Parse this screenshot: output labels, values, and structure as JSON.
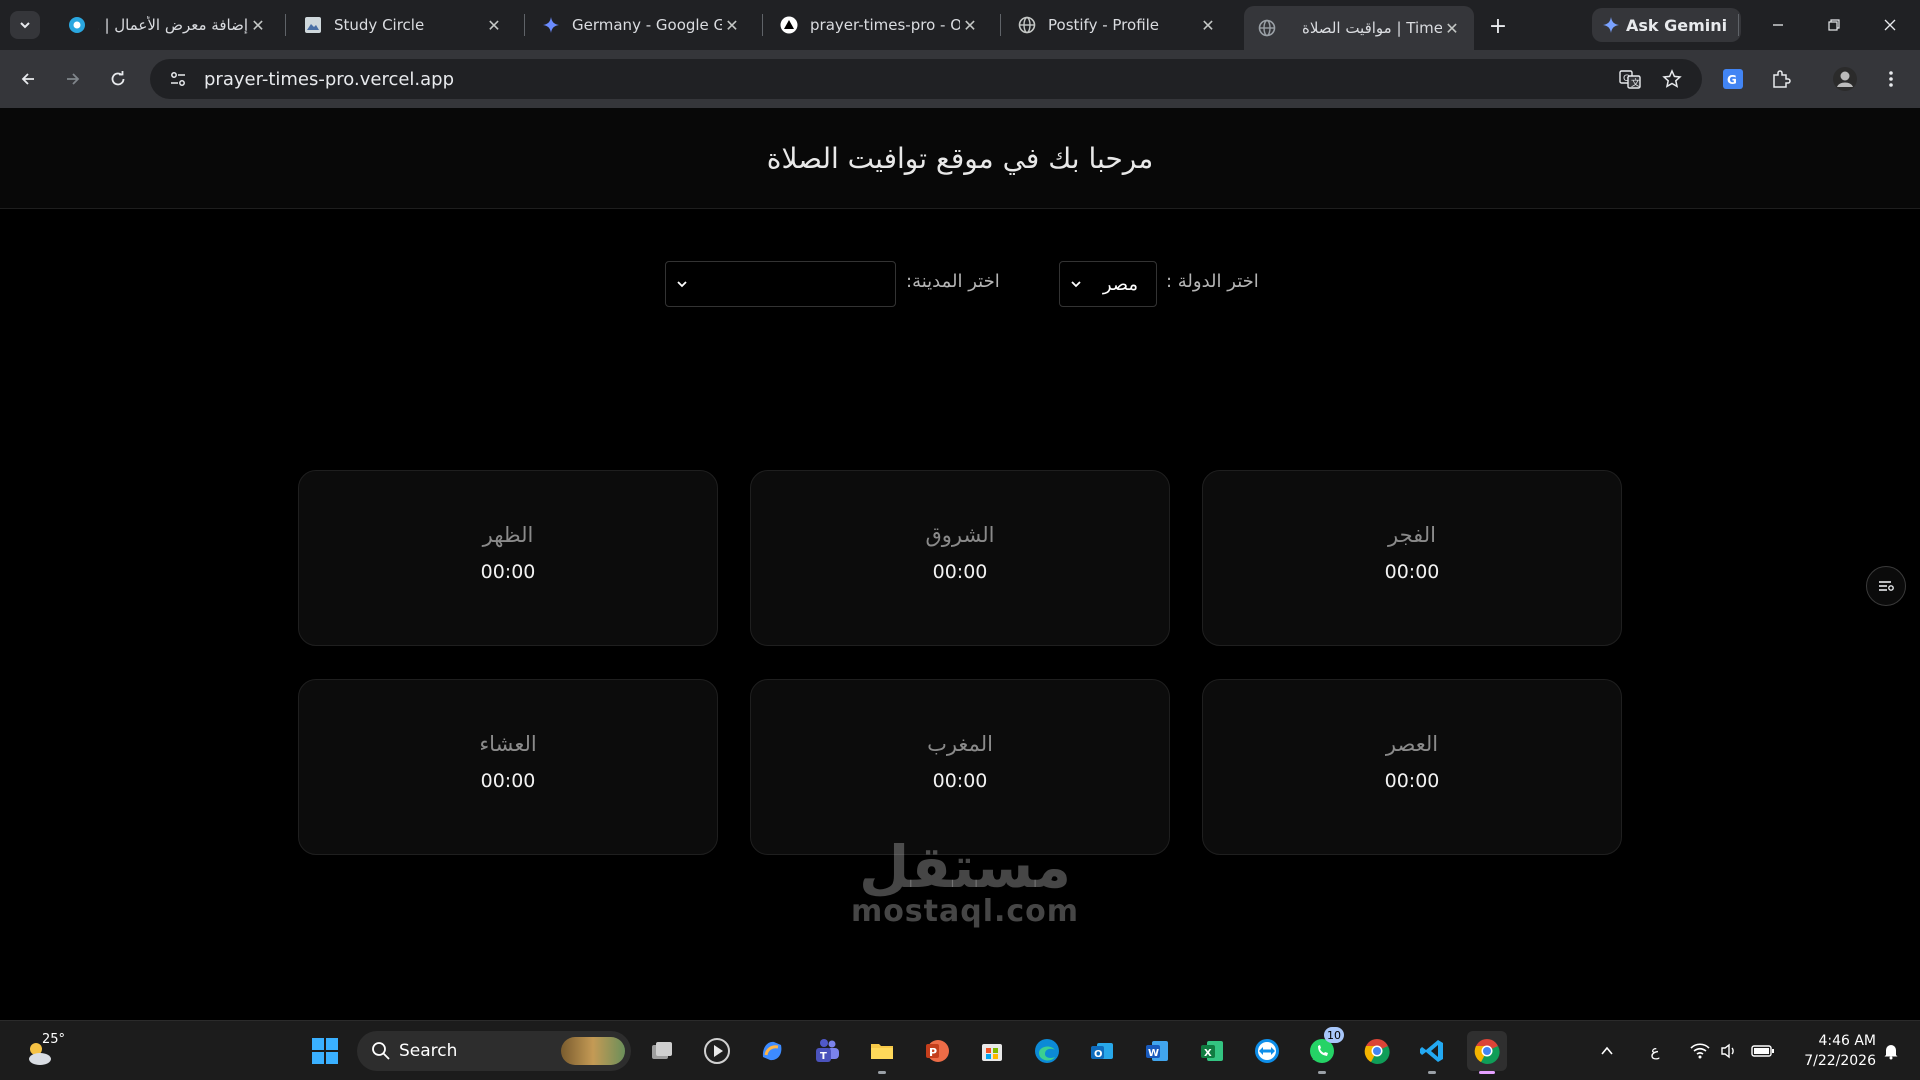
{
  "browser": {
    "tabs": [
      {
        "title": "إضافة معرض الأعمال | ..",
        "active": false
      },
      {
        "title": "Study Circle",
        "active": false
      },
      {
        "title": "Germany - Google Gen",
        "active": false
      },
      {
        "title": "prayer-times-pro - Ove",
        "active": false
      },
      {
        "title": "Postify - Profile",
        "active": false
      },
      {
        "title": "مواقيت الصلاة | Times",
        "active": true
      }
    ],
    "new_tab": "+",
    "ask_gemini": "Ask Gemini",
    "url": "prayer-times-pro.vercel.app"
  },
  "page": {
    "title": "مرحبا بك في موقع توافيت الصلاة",
    "country_label": "اختر الدولة :",
    "country_value": "مصر",
    "city_label": "اختر المدينة:",
    "city_value": "",
    "prayers": [
      {
        "name": "الفجر",
        "time": "00:00"
      },
      {
        "name": "الشروق",
        "time": "00:00"
      },
      {
        "name": "الظهر",
        "time": "00:00"
      },
      {
        "name": "العصر",
        "time": "00:00"
      },
      {
        "name": "المغرب",
        "time": "00:00"
      },
      {
        "name": "العشاء",
        "time": "00:00"
      }
    ],
    "watermark": {
      "arabic": "مستقل",
      "latin": "mostaql.com"
    }
  },
  "taskbar": {
    "weather_temp": "25°",
    "search_label": "Search",
    "whatsapp_badge": "10",
    "keyboard_lang": "ع",
    "time": "4:46 AM",
    "date": "7/22/2026"
  },
  "colors": {
    "page_bg": "#000000",
    "card_bg": "#0c0c0c",
    "tab_strip": "#202124",
    "toolbar": "#35363a"
  }
}
